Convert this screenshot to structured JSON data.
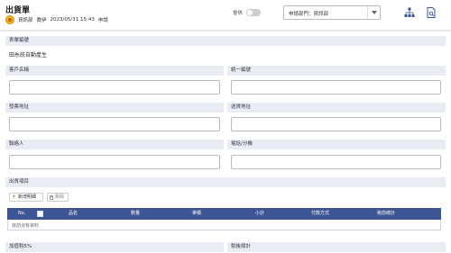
{
  "header": {
    "title": "出貨單",
    "department": "資訊部",
    "user": "喬伊",
    "datetime": "2023/05/31 15:43",
    "status": "申請",
    "draft_label": "會休",
    "dept_select_value": "申請部門：資訊部"
  },
  "form": {
    "form_number_label": "表單編號",
    "form_number_value": "田糸統自動產生",
    "customer_name_label": "客戶名稱",
    "tax_id_label": "統一編號",
    "invoice_address_label": "發票地址",
    "delivery_address_label": "送貨地址",
    "contact_label": "聯絡人",
    "phone_label": "電話/分機",
    "items_label": "出貨項目",
    "add_detail_button": "新增明細",
    "delete_button": "刪除",
    "tax_label": "加值稅5%",
    "total_label": "稅後總計"
  },
  "table": {
    "columns": [
      "No.",
      "品名",
      "數量",
      "單價",
      "小計",
      "付款方式",
      "稅前總計"
    ],
    "empty_text": "目前沒有資料"
  }
}
